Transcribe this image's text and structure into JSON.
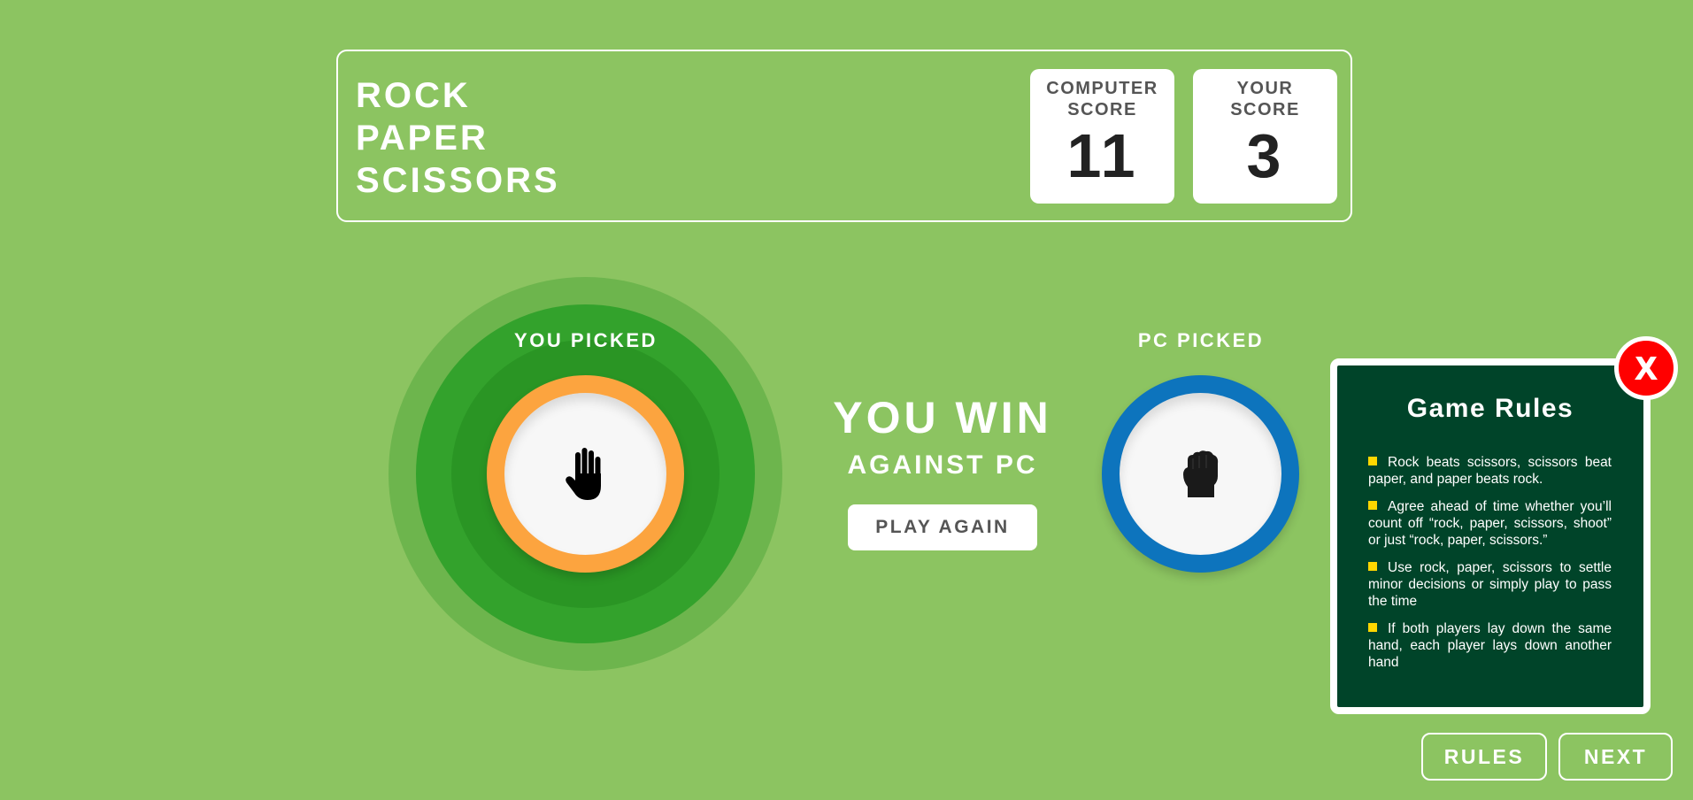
{
  "header": {
    "title_lines": [
      "ROCK",
      "PAPER",
      "SCISSORS"
    ],
    "computer_score": {
      "label_lines": [
        "COMPUTER",
        "SCORE"
      ],
      "value": "11"
    },
    "user_score": {
      "label_lines": [
        "YOUR",
        "SCORE"
      ],
      "value": "3"
    }
  },
  "game": {
    "you_picked_label": "YOU PICKED",
    "pc_picked_label": "PC PICKED",
    "you_choice": "paper",
    "pc_choice": "rock",
    "you_icon": "raised-hand-icon",
    "pc_icon": "fist-icon",
    "result_main": "YOU WIN",
    "result_sub": "AGAINST PC",
    "play_again_label": "PLAY AGAIN"
  },
  "rules": {
    "title": "Game Rules",
    "items": [
      "Rock beats scissors, scissors beat paper, and paper beats rock.",
      "Agree ahead of time whether you’ll count off “rock, paper, scissors, shoot” or just “rock, paper, scissors.”",
      "Use rock, paper, scissors to settle minor decisions or simply play to pass the time",
      "If both players lay down the same hand, each player lays down another hand"
    ],
    "close_icon": "close-x-icon",
    "close_glyph": "X"
  },
  "footer": {
    "rules_label": "RULES",
    "next_label": "NEXT"
  },
  "colors": {
    "background": "#8cc461",
    "paper_ring": "#fca43f",
    "rock_ring": "#0d74bd",
    "winner_glow": "#33a22c",
    "rules_panel": "#004429",
    "close_button": "#ff0000",
    "bullet": "#ffd700"
  }
}
